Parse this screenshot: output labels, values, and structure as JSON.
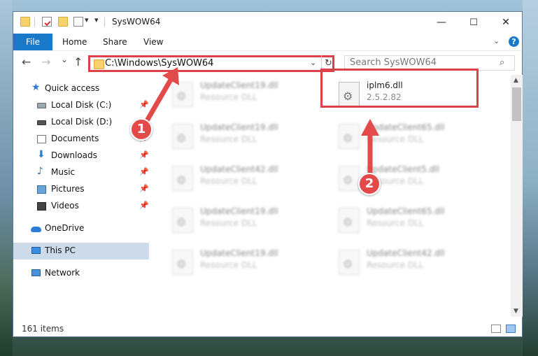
{
  "window": {
    "title": "SysWOW64",
    "controls": {
      "minimize": "—",
      "maximize": "☐",
      "close": "✕"
    }
  },
  "ribbon": {
    "tabs": [
      "File",
      "Home",
      "Share",
      "View"
    ]
  },
  "navigation": {
    "back": "←",
    "forward": "→",
    "recent": "⌄",
    "up": "↑",
    "address": "C:\\Windows\\SysWOW64",
    "refresh": "↻",
    "search_placeholder": "Search SysWOW64"
  },
  "sidebar": {
    "items": [
      {
        "label": "Quick access",
        "icon": "star-icon"
      },
      {
        "label": "Local Disk (C:)",
        "icon": "disk-icon",
        "pinned": true
      },
      {
        "label": "Local Disk (D:)",
        "icon": "disk-icon"
      },
      {
        "label": "Documents",
        "icon": "documents-icon",
        "pinned": true
      },
      {
        "label": "Downloads",
        "icon": "downloads-icon",
        "pinned": true
      },
      {
        "label": "Music",
        "icon": "music-icon",
        "pinned": true
      },
      {
        "label": "Pictures",
        "icon": "pictures-icon",
        "pinned": true
      },
      {
        "label": "Videos",
        "icon": "videos-icon",
        "pinned": true
      },
      {
        "label": "OneDrive",
        "icon": "onedrive-icon"
      },
      {
        "label": "This PC",
        "icon": "pc-icon",
        "selected": true
      },
      {
        "label": "Network",
        "icon": "network-icon"
      }
    ]
  },
  "files": {
    "left_column": [
      {
        "name": "UpdateClient19.dll",
        "type": "Resource DLL"
      },
      {
        "name": "UpdateClient19.dll",
        "type": "Resource DLL"
      },
      {
        "name": "UpdateClient42.dll",
        "type": "Resource DLL"
      },
      {
        "name": "UpdateClient19.dll",
        "type": "Resource DLL"
      },
      {
        "name": "UpdateClient19.dll",
        "type": "Resource DLL"
      }
    ],
    "right_column": [
      {
        "name": "iplm6.dll",
        "type": "2.5.2.82",
        "highlighted": true
      },
      {
        "name": "UpdateClient65.dll",
        "type": "Resource DLL"
      },
      {
        "name": "UpdateClient5.dll",
        "type": "Resource DLL"
      },
      {
        "name": "UpdateClient65.dll",
        "type": "Resource DLL"
      },
      {
        "name": "UpdateClient42.dll",
        "type": "Resource DLL"
      }
    ]
  },
  "status": {
    "item_count": "161 items"
  },
  "annotations": {
    "step1": "1",
    "step2": "2",
    "color": "#e34a4a"
  }
}
